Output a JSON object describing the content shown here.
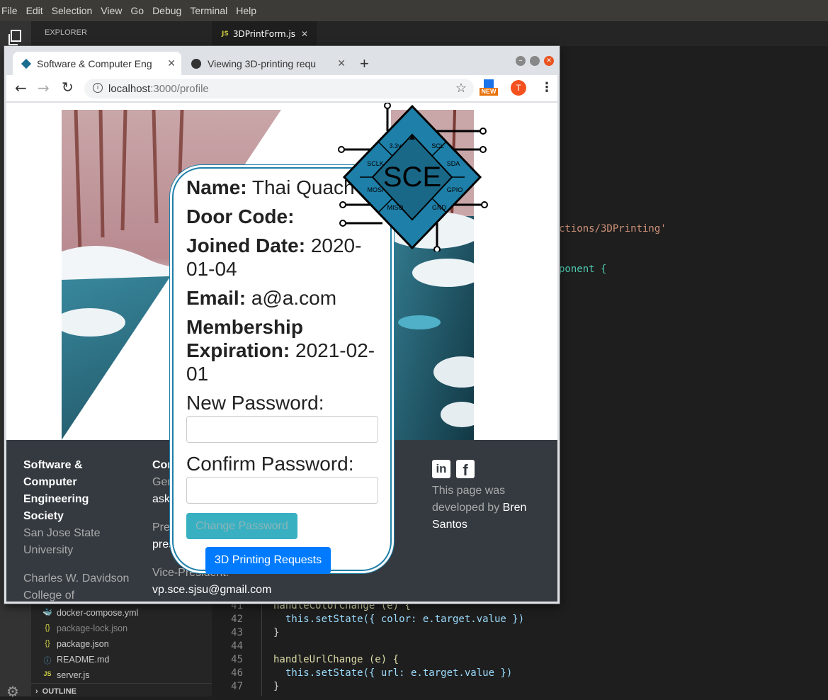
{
  "menu": [
    "File",
    "Edit",
    "Selection",
    "View",
    "Go",
    "Debug",
    "Terminal",
    "Help"
  ],
  "sidebar": {
    "title": "EXPLORER",
    "files": [
      {
        "icon": "docker-icon",
        "name": "docker-compose.yml",
        "color": "#cccccc"
      },
      {
        "icon": "json-icon",
        "name": "package-lock.json",
        "color": "#8a8a8a"
      },
      {
        "icon": "json-icon",
        "name": "package.json",
        "color": "#cccccc"
      },
      {
        "icon": "info-icon",
        "name": "README.md",
        "color": "#cccccc"
      },
      {
        "icon": "js-icon",
        "name": "server.js",
        "color": "#cccccc"
      }
    ],
    "outline": "OUTLINE"
  },
  "editor": {
    "tab": "3DPrintForm.js",
    "js_badge": "JS",
    "fragment1": "ctions/3DPrinting'",
    "fragment2": "ponent {",
    "lines": [
      {
        "n": "41",
        "text": "handleColorChange (e) {"
      },
      {
        "n": "42",
        "text": "this.setState({ color: e.target.value })"
      },
      {
        "n": "43",
        "text": "}"
      },
      {
        "n": "44",
        "text": ""
      },
      {
        "n": "45",
        "text": "handleUrlChange (e) {"
      },
      {
        "n": "46",
        "text": "this.setState({ url: e.target.value })"
      },
      {
        "n": "47",
        "text": "}"
      }
    ]
  },
  "browser": {
    "tab1": "Software & Computer Eng",
    "tab2": "Viewing 3D-printing requ",
    "url_host": "localhost",
    "url_path": ":3000/profile",
    "new_badge": "NEW",
    "avatar_letter": "T"
  },
  "logo": {
    "center": "SCE",
    "pins": [
      "3.3v",
      "SCL",
      "SCLK",
      "SDA",
      "MOSI",
      "GPIO",
      "MISO",
      "GND"
    ]
  },
  "profile": {
    "name_label": "Name:",
    "name_value": "Thai Quach",
    "door_label": "Door Code:",
    "door_value": "",
    "joined_label": "Joined Date:",
    "joined_value": "2020-01-04",
    "email_label": "Email:",
    "email_value": "a@a.com",
    "membership_label1": "Membership",
    "membership_label2": "Expiration:",
    "membership_value": "2021-02-01",
    "new_password_label": "New Password:",
    "confirm_password_label": "Confirm Password:",
    "change_password_button": "Change Password",
    "print_requests_button": "3D Printing Requests"
  },
  "footer": {
    "org": "Software & Computer Engineering Society",
    "university": "San Jose State University",
    "college": "Charles W. Davidson College of",
    "contact_heading": "Con",
    "general_label": "Gen",
    "general_email": "asks",
    "president_label": "Pres",
    "president_email": "pres",
    "vp_label": "Vice-President:",
    "vp_email": "vp.sce.sjsu@gmail.com",
    "developed_by": "This page was developed by",
    "developer": "Bren Santos"
  }
}
